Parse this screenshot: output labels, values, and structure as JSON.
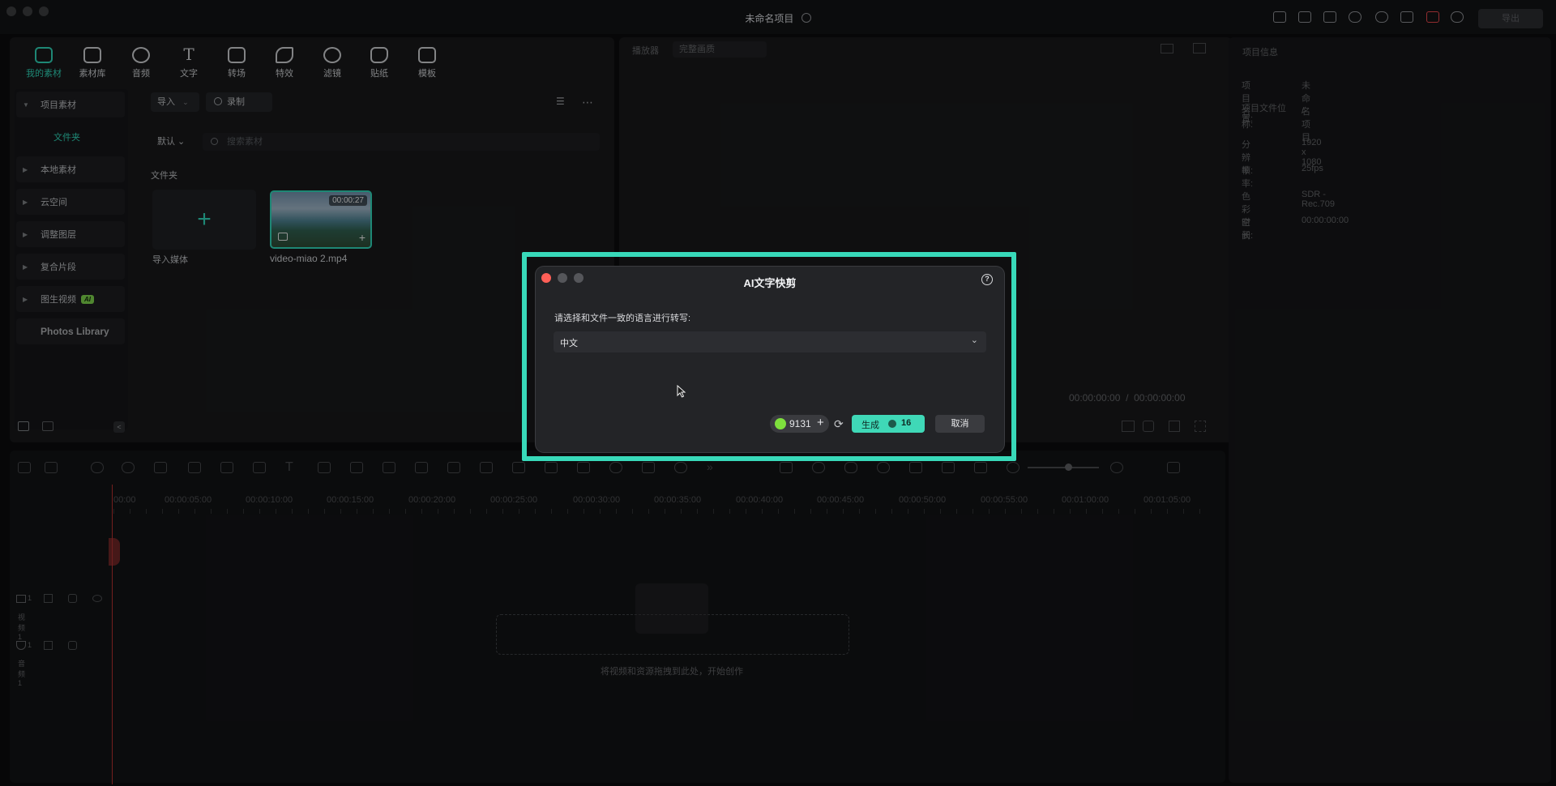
{
  "window": {
    "title": "未命名项目"
  },
  "top_right": {
    "export_label": "导出"
  },
  "toolbar": {
    "tabs": [
      {
        "label": "我的素材",
        "icon": "my-media-icon"
      },
      {
        "label": "素材库",
        "icon": "store-icon"
      },
      {
        "label": "音频",
        "icon": "music-icon"
      },
      {
        "label": "文字",
        "icon": "text-icon"
      },
      {
        "label": "转场",
        "icon": "transition-icon"
      },
      {
        "label": "特效",
        "icon": "effects-icon"
      },
      {
        "label": "滤镜",
        "icon": "filter-icon"
      },
      {
        "label": "贴纸",
        "icon": "sticker-icon"
      },
      {
        "label": "模板",
        "icon": "template-icon"
      }
    ]
  },
  "sidebar": {
    "items": [
      "项目素材",
      "文件夹",
      "本地素材",
      "云空间",
      "调整图层",
      "复合片段",
      "图生视频",
      "Photos Library"
    ],
    "ai_badge": "AI"
  },
  "media": {
    "import_label": "导入",
    "record_label": "录制",
    "sort_label": "默认",
    "search_placeholder": "搜索素材",
    "folder_heading": "文件夹",
    "import_media_label": "导入媒体",
    "clip_name": "video-miao 2.mp4",
    "clip_duration": "00:00:27"
  },
  "player": {
    "label": "播放器",
    "mode": "完整画质",
    "time_current": "00:00:00:00",
    "time_separator": "/",
    "time_total": "00:00:00:00"
  },
  "project_info": {
    "heading": "项目信息",
    "rows": [
      {
        "label": "项目名称:",
        "value": "未命名项目"
      },
      {
        "label": "项目文件位置:",
        "value": "/"
      },
      {
        "label": "分辨率:",
        "value": "1920 x 1080"
      },
      {
        "label": "帧率:",
        "value": "25fps"
      },
      {
        "label": "色彩空间:",
        "value": "SDR - Rec.709"
      },
      {
        "label": "时长:",
        "value": "00:00:00:00"
      }
    ]
  },
  "timeline": {
    "ruler": [
      "00:00",
      "00:00:05:00",
      "00:00:10:00",
      "00:00:15:00",
      "00:00:20:00",
      "00:00:25:00",
      "00:00:30:00",
      "00:00:35:00",
      "00:00:40:00",
      "00:00:45:00",
      "00:00:50:00",
      "00:00:55:00",
      "00:01:00:00",
      "00:01:05:00"
    ],
    "video_track": "视频 1",
    "audio_track": "音频 1",
    "track_num": "1",
    "drop_hint": "将视频和资源拖拽到此处，开始创作"
  },
  "dialog": {
    "title": "AI文字快剪",
    "prompt": "请选择和文件一致的语言进行转写:",
    "language": "中文",
    "credits": "9131",
    "generate_label": "生成",
    "generate_cost": "16",
    "cancel_label": "取消"
  },
  "colors": {
    "accent": "#38d9b9",
    "close": "#ff5f57",
    "bg": "#0b0c0d"
  }
}
